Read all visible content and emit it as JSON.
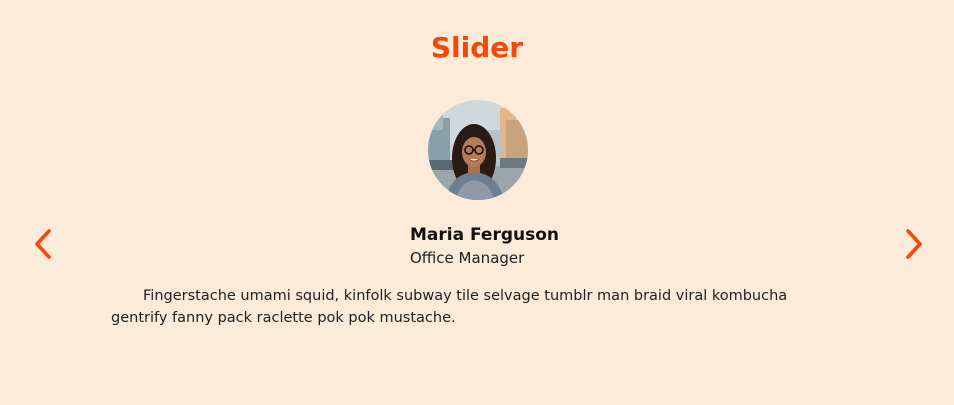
{
  "slider": {
    "title": "Slider",
    "accent_color": "#f2490c",
    "background_color": "#fbebd8",
    "prev_icon": "chevron-left-icon",
    "next_icon": "chevron-right-icon",
    "person": {
      "name": "Maria Ferguson",
      "role": "Office Manager",
      "quote": "Fingerstache umami squid, kinfolk subway tile selvage tumblr man braid viral kombucha gentrify fanny pack raclette pok pok mustache."
    }
  }
}
